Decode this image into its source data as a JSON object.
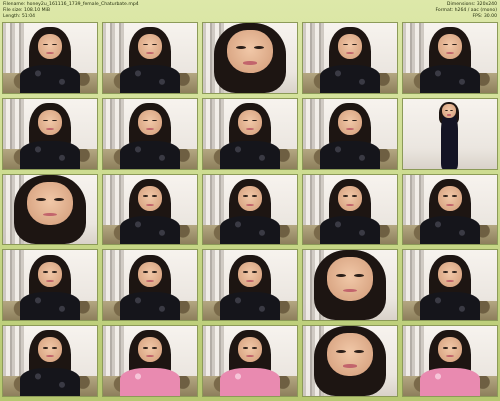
{
  "header": {
    "filename": "Filename: honey2u_161116_1739_female_Chaturbate.mp4",
    "filesize": "File size: 108.10 MiB",
    "length": "Length: 51:04",
    "dimensions": "Dimensions: 320x240",
    "format": "Format: h264 / aac (mono)",
    "fps": "FPS: 30.00"
  },
  "thumbnails": [
    {
      "label": "",
      "variant": "normal"
    },
    {
      "label": "",
      "variant": "normal"
    },
    {
      "label": "",
      "variant": "close"
    },
    {
      "label": "",
      "variant": "normal"
    },
    {
      "label": "",
      "variant": "normal"
    },
    {
      "label": "",
      "variant": "normal"
    },
    {
      "label": "",
      "variant": "normal"
    },
    {
      "label": "",
      "variant": "normal"
    },
    {
      "label": "",
      "variant": "normal"
    },
    {
      "label": "",
      "variant": "standing"
    },
    {
      "label": "",
      "variant": "close"
    },
    {
      "label": "",
      "variant": "normal"
    },
    {
      "label": "",
      "variant": "normal"
    },
    {
      "label": "",
      "variant": "normal"
    },
    {
      "label": "",
      "variant": "normal"
    },
    {
      "label": "",
      "variant": "normal"
    },
    {
      "label": "",
      "variant": "normal"
    },
    {
      "label": "",
      "variant": "normal"
    },
    {
      "label": "",
      "variant": "close"
    },
    {
      "label": "",
      "variant": "normal"
    },
    {
      "label": "",
      "variant": "normal"
    },
    {
      "label": "",
      "variant": "pink"
    },
    {
      "label": "",
      "variant": "pink"
    },
    {
      "label": "",
      "variant": "close"
    },
    {
      "label": "",
      "variant": "pink"
    }
  ],
  "colors": {
    "background_top": "#dde8a9",
    "background_bottom": "#b6c870",
    "header_text": "#1f2a0a"
  }
}
